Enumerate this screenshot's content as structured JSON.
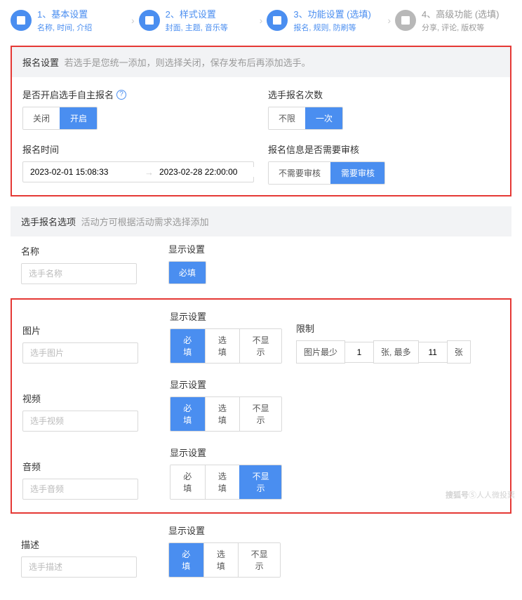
{
  "steps": [
    {
      "title": "1、基本设置",
      "sub": "名称, 时间, 介绍"
    },
    {
      "title": "2、样式设置",
      "sub": "封面, 主题, 音乐等"
    },
    {
      "title": "3、功能设置 (选填)",
      "sub": "报名, 规则, 防刷等"
    },
    {
      "title": "4、高级功能 (选填)",
      "sub": "分享, 评论, 版权等"
    }
  ],
  "registration": {
    "header_title": "报名设置",
    "header_desc": "若选手是您统一添加，则选择关闭，保存发布后再添加选手。",
    "enable_label": "是否开启选手自主报名",
    "enable_options": {
      "off": "关闭",
      "on": "开启"
    },
    "count_label": "选手报名次数",
    "count_options": {
      "unlimited": "不限",
      "once": "一次"
    },
    "time_label": "报名时间",
    "time_start": "2023-02-01 15:08:33",
    "time_end": "2023-02-28 22:00:00",
    "audit_label": "报名信息是否需要审核",
    "audit_options": {
      "no": "不需要审核",
      "yes": "需要审核"
    }
  },
  "options": {
    "header_title": "选手报名选项",
    "header_desc": "活动方可根据活动需求选择添加",
    "name_label": "名称",
    "display_label": "显示设置",
    "limit_label": "限制",
    "display_opts": {
      "required": "必填",
      "optional": "选填",
      "hidden": "不显示"
    },
    "rows": {
      "name": {
        "label": "名称",
        "placeholder": "选手名称"
      },
      "image": {
        "label": "图片",
        "placeholder": "选手图片"
      },
      "video": {
        "label": "视频",
        "placeholder": "选手视频"
      },
      "audio": {
        "label": "音频",
        "placeholder": "选手音频"
      },
      "desc": {
        "label": "描述",
        "placeholder": "选手描述"
      }
    },
    "limit": {
      "prefix": "图片最少",
      "min": "1",
      "mid": "张, 最多",
      "max": "11",
      "suffix": "张"
    }
  },
  "watermark": {
    "brand": "搜狐号",
    "author": "人人微投票"
  }
}
